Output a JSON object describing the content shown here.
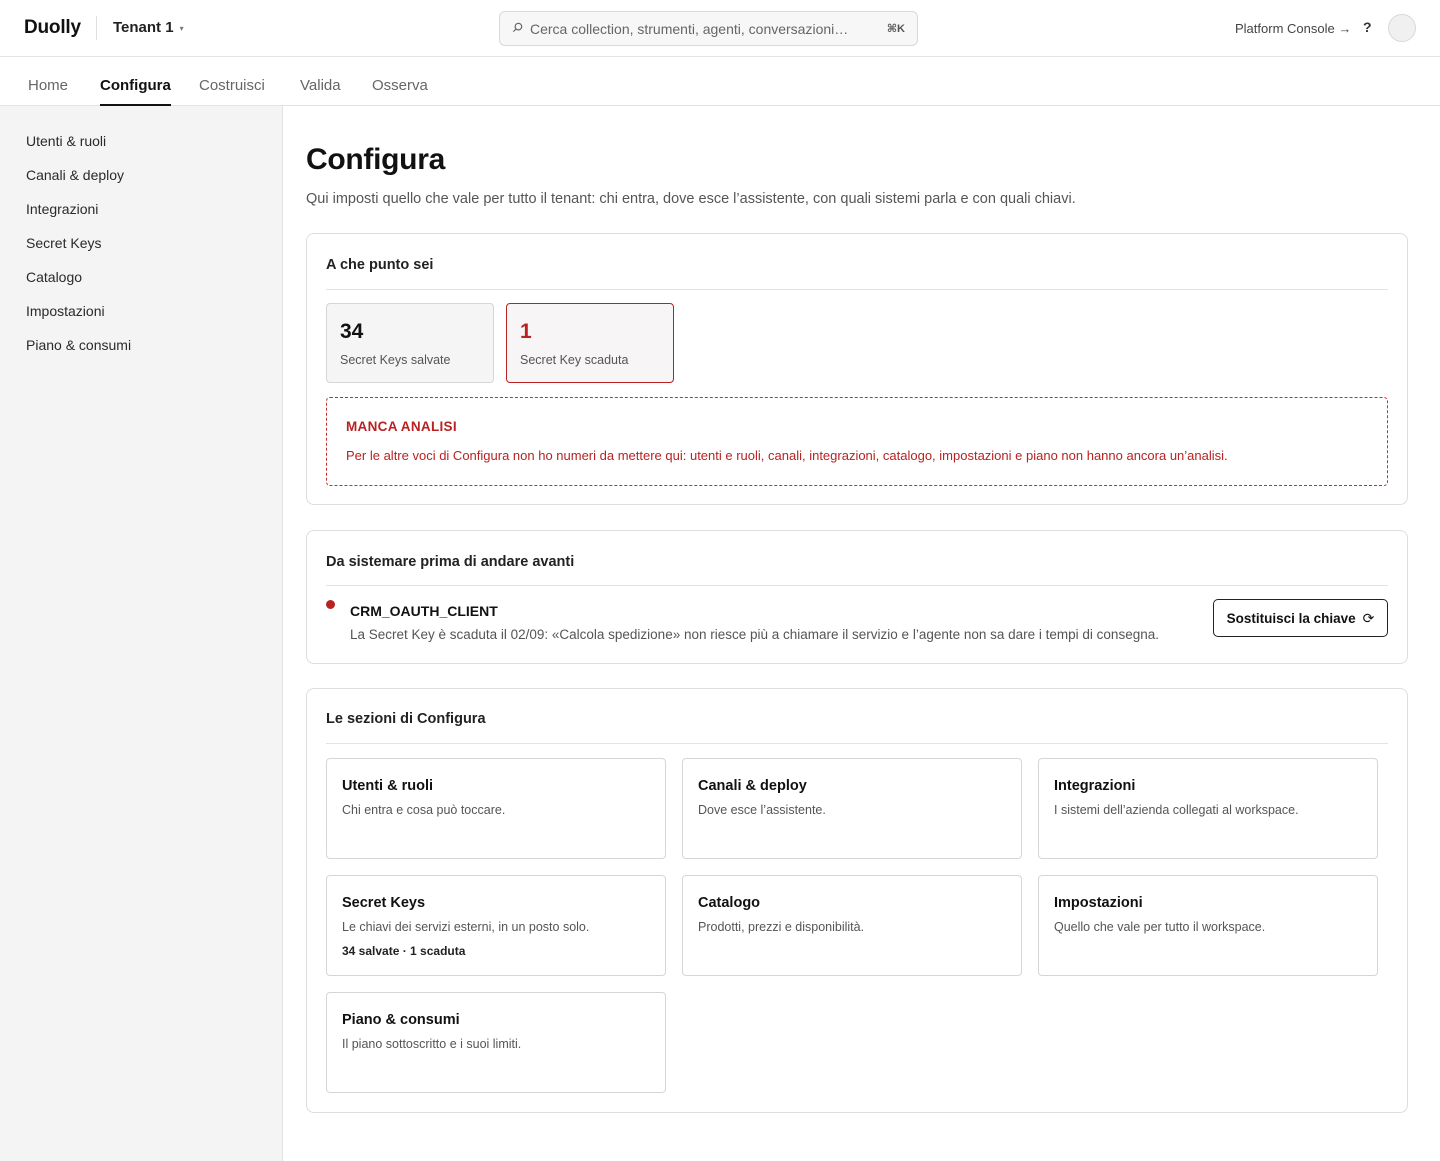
{
  "header": {
    "brand": "Duolly",
    "tenant": "Tenant 1",
    "tenant_caret": "▾",
    "search_placeholder": "Cerca collection, strumenti, agenti, conversazioni…",
    "search_shortcut": "⌘K",
    "platform_console": "Platform Console →",
    "help": "?"
  },
  "tabs": [
    {
      "label": "Home",
      "active": false
    },
    {
      "label": "Configura",
      "active": true
    },
    {
      "label": "Costruisci",
      "active": false
    },
    {
      "label": "Valida",
      "active": false
    },
    {
      "label": "Osserva",
      "active": false
    }
  ],
  "sidebar": {
    "items": [
      {
        "label": "Utenti & ruoli"
      },
      {
        "label": "Canali & deploy"
      },
      {
        "label": "Integrazioni"
      },
      {
        "label": "Secret Keys"
      },
      {
        "label": "Catalogo"
      },
      {
        "label": "Impostazioni"
      },
      {
        "label": "Piano & consumi"
      }
    ]
  },
  "main": {
    "title": "Configura",
    "subtitle": "Qui imposti quello che vale per tutto il tenant: chi entra, dove esce l’assistente, con quali sistemi parla e con quali chiavi.",
    "status": {
      "title": "A che punto sei",
      "stats": [
        {
          "value": "34",
          "label": "Secret Keys salvate"
        },
        {
          "value": "1",
          "label": "Secret Key scaduta"
        }
      ],
      "missing": {
        "title": "MANCA ANALISI",
        "text": "Per le altre voci di Configura non ho numeri da mettere qui: utenti e ruoli, canali, integrazioni, catalogo, impostazioni e piano non hanno ancora un’analisi."
      }
    },
    "todo": {
      "title": "Da sistemare prima di andare avanti",
      "issue_name": "CRM_OAUTH_CLIENT",
      "issue_desc": "La Secret Key è scaduta il 02/09: «Calcola spedizione» non riesce più a chiamare il servizio e l’agente non sa dare i tempi di consegna.",
      "button": "Sostituisci la chiave",
      "button_icon": "⟳"
    },
    "sections": {
      "title": "Le sezioni di Configura",
      "tiles": [
        {
          "title": "Utenti & ruoli",
          "desc": "Chi entra e cosa può toccare."
        },
        {
          "title": "Canali & deploy",
          "desc": "Dove esce l’assistente."
        },
        {
          "title": "Integrazioni",
          "desc": "I sistemi dell’azienda collegati al workspace."
        },
        {
          "title": "Secret Keys",
          "desc": "Le chiavi dei servizi esterni, in un posto solo.",
          "meta": "34 salvate · 1 scaduta"
        },
        {
          "title": "Catalogo",
          "desc": "Prodotti, prezzi e disponibilità."
        },
        {
          "title": "Impostazioni",
          "desc": "Quello che vale per tutto il workspace."
        },
        {
          "title": "Piano & consumi",
          "desc": "Il piano sottoscritto e i suoi limiti."
        }
      ]
    }
  },
  "colors": {
    "alert": "#b82222",
    "sidebar_bg": "#f4f4f4",
    "text": "#111111"
  }
}
